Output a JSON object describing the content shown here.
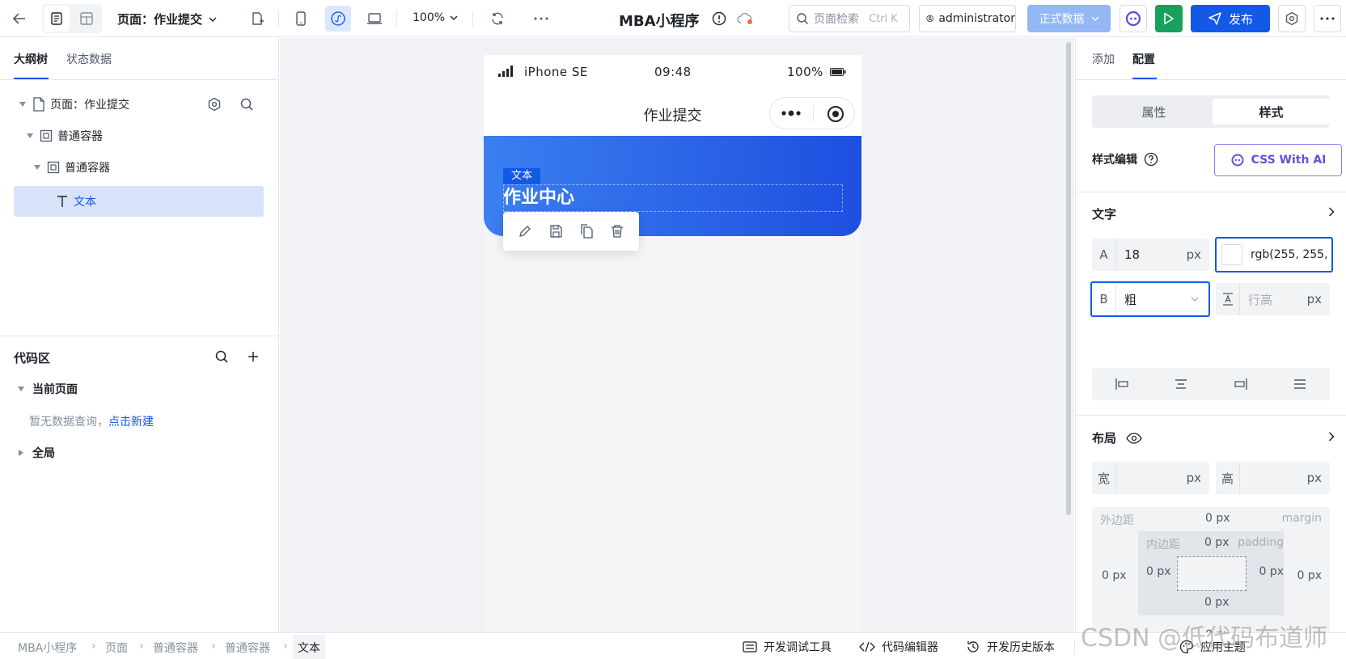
{
  "topbar": {
    "page_title": "页面：作业提交",
    "zoom": "100%",
    "app_name": "MBA小程序",
    "search_placeholder": "页面检索",
    "search_shortcut": "Ctrl K",
    "user": "administrator",
    "data_env": "正式数据",
    "publish": "发布"
  },
  "left": {
    "tabs": [
      "大纲树",
      "状态数据"
    ],
    "tree": [
      {
        "label": "页面：作业提交"
      },
      {
        "label": "普通容器"
      },
      {
        "label": "普通容器"
      },
      {
        "label": "文本"
      }
    ],
    "code_title": "代码区",
    "current_page": "当前页面",
    "empty_hint": "暂无数据查询，",
    "create_link": "点击新建",
    "global": "全局"
  },
  "phone": {
    "carrier": "iPhone SE",
    "time": "09:48",
    "battery": "100%",
    "nav_title": "作业提交",
    "selected_tag": "文本",
    "hero_text": "作业中心"
  },
  "right": {
    "tabs": [
      "添加",
      "配置"
    ],
    "segments": [
      "属性",
      "样式"
    ],
    "style_edit": "样式编辑",
    "css_ai": "CSS With AI",
    "text_section": "文字",
    "font_size_prefix": "A",
    "font_size": "18",
    "unit": "px",
    "color_value": "rgb(255, 255,",
    "weight_prefix": "B",
    "weight": "粗",
    "line_height_ph": "行高",
    "layout_section": "布局",
    "width_label": "宽",
    "height_label": "高",
    "margin_label": "外边距",
    "margin_en": "margin",
    "padding_label": "内边距",
    "padding_en": "padding",
    "zero_px": "0 px"
  },
  "bottom": {
    "breadcrumb": [
      "MBA小程序",
      "页面",
      "普通容器",
      "普通容器",
      "文本"
    ],
    "dev_tools": "开发调试工具",
    "code_editor": "代码编辑器",
    "history": "开发历史版本",
    "theme": "应用主题"
  },
  "watermark": "CSDN @低代码布道师",
  "colors": {
    "primary": "#1259e8",
    "run": "#19a05c",
    "hero_start": "#3a7ff0",
    "hero_end": "#1e4fe0"
  }
}
